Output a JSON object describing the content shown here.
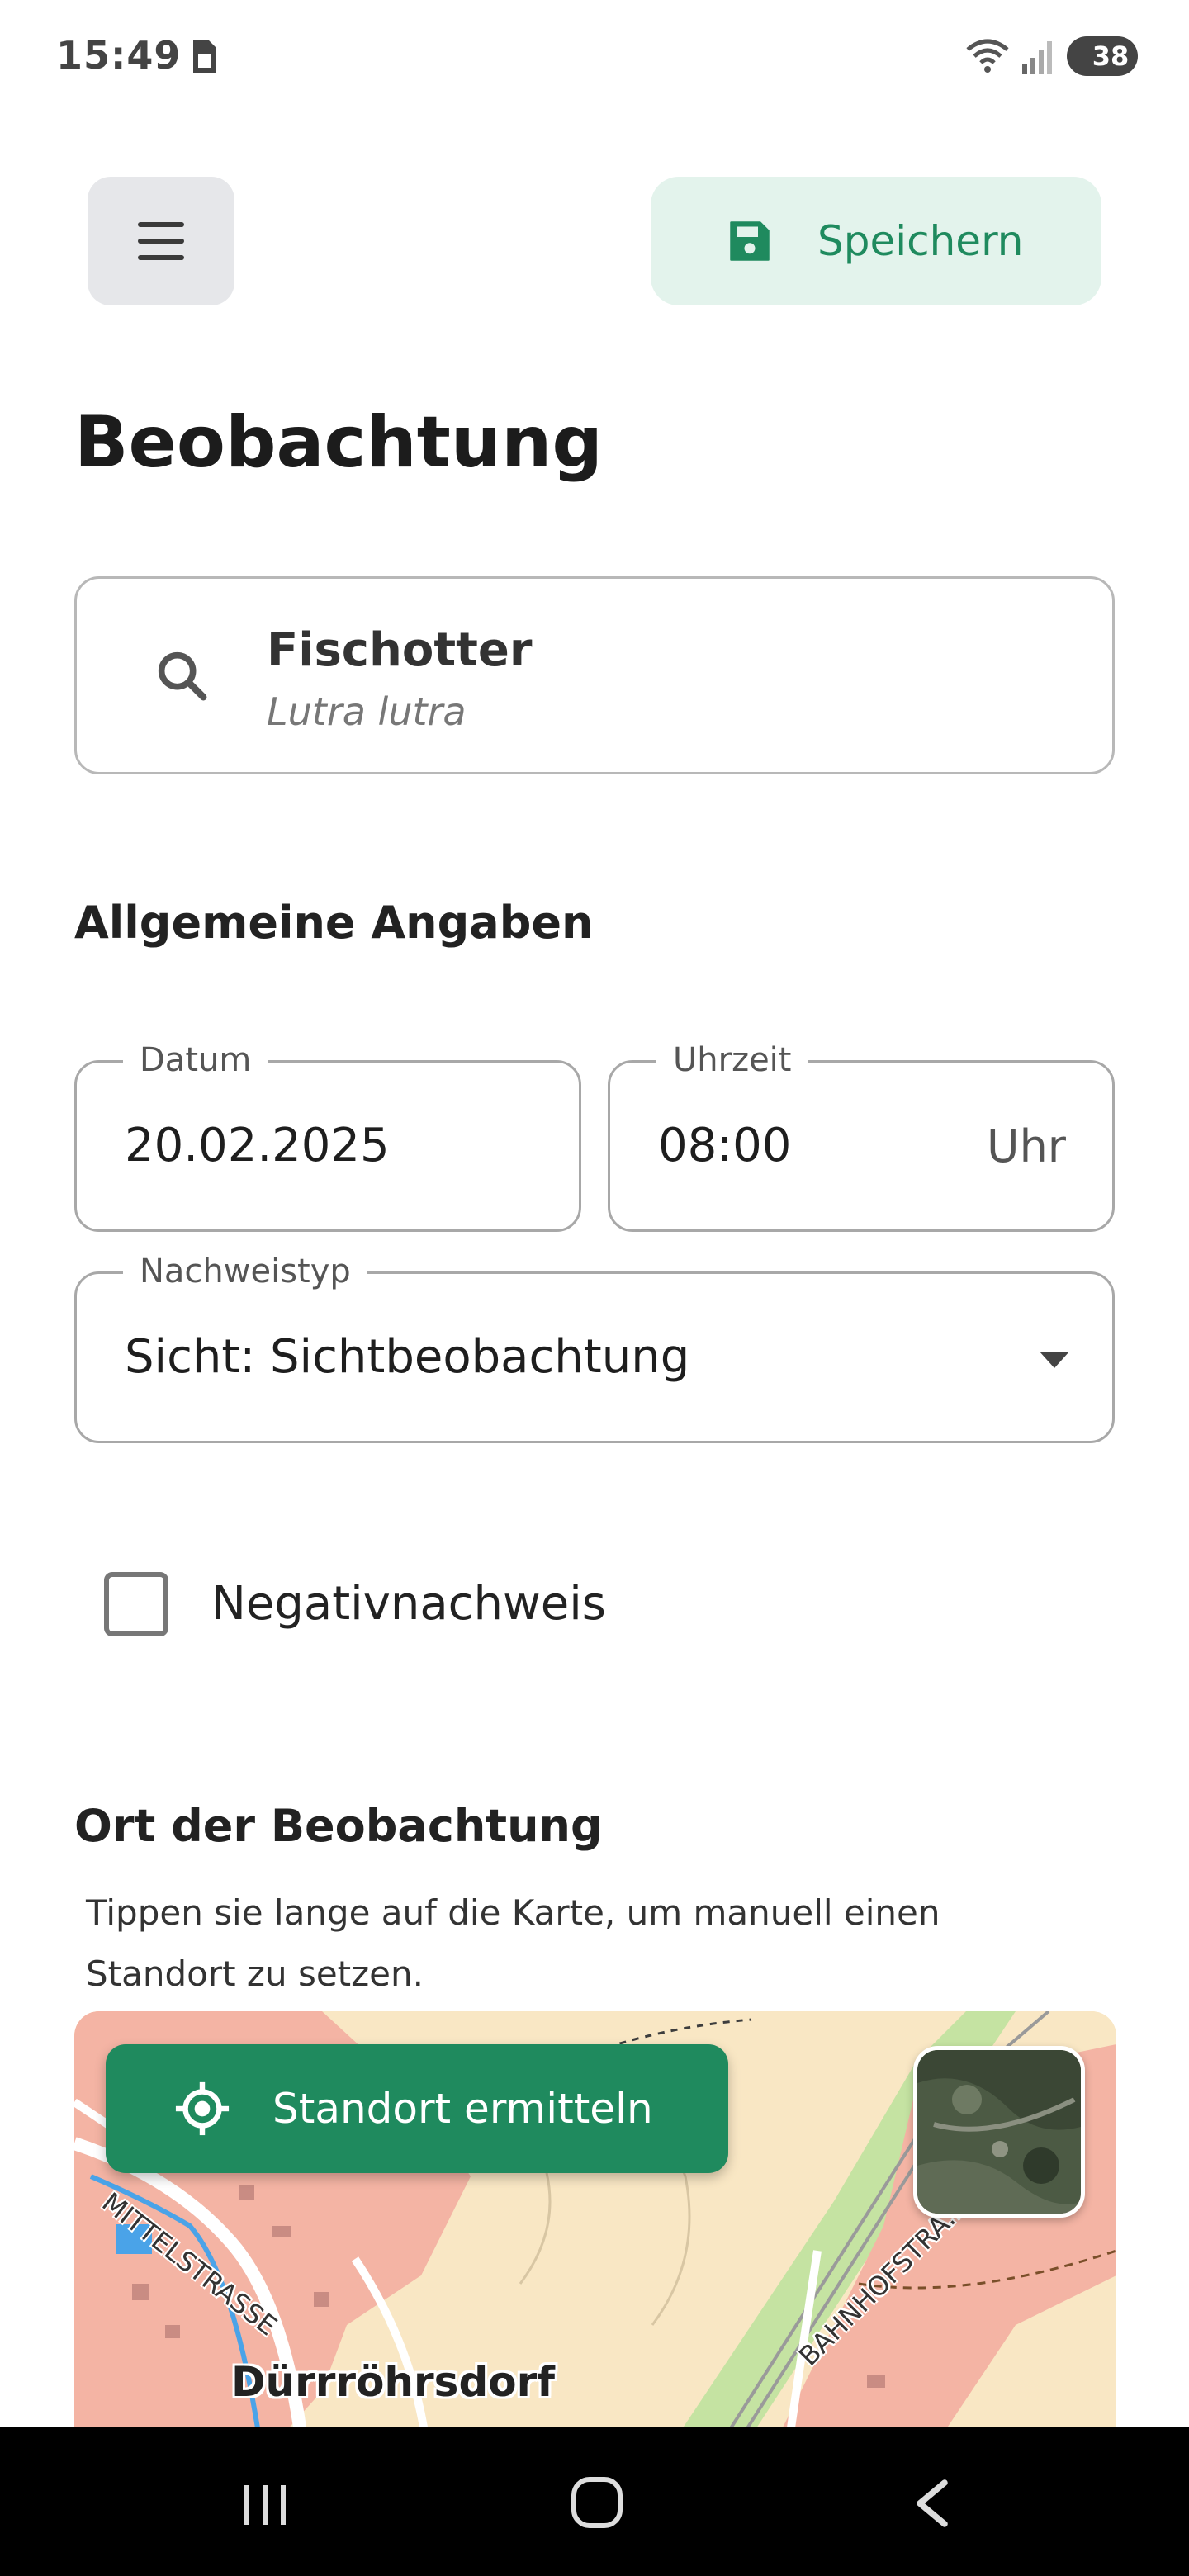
{
  "status_bar": {
    "time": "15:49",
    "battery": "38"
  },
  "header": {
    "save_label": "Speichern"
  },
  "page_title": "Beobachtung",
  "species": {
    "common_name": "Fischotter",
    "latin_name": "Lutra lutra"
  },
  "general": {
    "section_title": "Allgemeine Angaben",
    "date": {
      "label": "Datum",
      "value": "20.02.2025"
    },
    "time": {
      "label": "Uhrzeit",
      "value": "08:00",
      "suffix": "Uhr"
    },
    "evidence_type": {
      "label": "Nachweistyp",
      "value": "Sicht: Sichtbeobachtung"
    },
    "negative_evidence": {
      "label": "Negativnachweis",
      "checked": false
    }
  },
  "location": {
    "section_title": "Ort der Beobachtung",
    "hint": "Tippen sie lange auf die Karte, um manuell einen Standort zu setzen.",
    "locate_label": "Standort ermitteln",
    "map_labels": {
      "town": "Dürrröhrsdorf",
      "street_1": "MITTELSTRASSE",
      "street_2": "BAHNHOFSTRA..."
    }
  },
  "colors": {
    "accent": "#1f8a5e",
    "accent_light": "#e3f3ec",
    "menu_bg": "#e6e7ea"
  }
}
